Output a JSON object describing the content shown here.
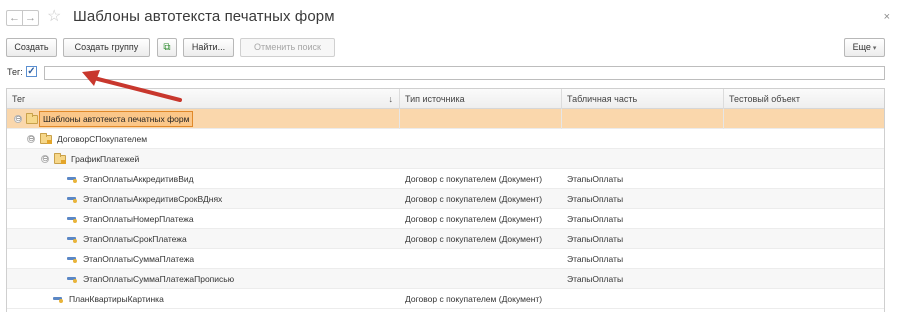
{
  "window": {
    "title": "Шаблоны автотекста печатных форм",
    "back_glyph": "←",
    "forward_glyph": "→",
    "star_glyph": "☆",
    "close_glyph": "×"
  },
  "toolbar": {
    "create_label": "Создать",
    "create_group_label": "Создать группу",
    "copy_glyph": "⧉",
    "find_label": "Найти...",
    "cancel_search_label": "Отменить поиск",
    "more_label": "Еще",
    "more_caret": "▾"
  },
  "filter": {
    "tag_label": "Тег:",
    "checked": true,
    "check_glyph": "✓",
    "value": ""
  },
  "table": {
    "columns": [
      "Тег",
      "Тип источника",
      "Табличная часть",
      "Тестовый объект"
    ],
    "sort_glyph": "↓",
    "rows": [
      {
        "tag": "Шаблоны автотекста печатных форм",
        "source": "",
        "tabular": "",
        "test": "",
        "kind": "root",
        "selected": true
      },
      {
        "tag": "ДоговорСПокупателем",
        "source": "",
        "tabular": "",
        "test": "",
        "kind": "group"
      },
      {
        "tag": "ГрафикПлатежей",
        "source": "",
        "tabular": "",
        "test": "",
        "kind": "group"
      },
      {
        "tag": "ЭтапОплатыАккредитивВид",
        "source": "Договор с покупателем (Документ)",
        "tabular": "ЭтапыОплаты",
        "test": "",
        "kind": "item"
      },
      {
        "tag": "ЭтапОплатыАккредитивСрокВДнях",
        "source": "Договор с покупателем (Документ)",
        "tabular": "ЭтапыОплаты",
        "test": "",
        "kind": "item"
      },
      {
        "tag": "ЭтапОплатыНомерПлатежа",
        "source": "Договор с покупателем (Документ)",
        "tabular": "ЭтапыОплаты",
        "test": "",
        "kind": "item"
      },
      {
        "tag": "ЭтапОплатыСрокПлатежа",
        "source": "Договор с покупателем (Документ)",
        "tabular": "ЭтапыОплаты",
        "test": "",
        "kind": "item"
      },
      {
        "tag": "ЭтапОплатыСуммаПлатежа",
        "source": "",
        "tabular": "ЭтапыОплаты",
        "test": "",
        "kind": "item"
      },
      {
        "tag": "ЭтапОплатыСуммаПлатежаПрописью",
        "source": "",
        "tabular": "ЭтапыОплаты",
        "test": "",
        "kind": "item"
      },
      {
        "tag": "ПланКвартирыКартинка",
        "source": "Договор с покупателем (Документ)",
        "tabular": "",
        "test": "",
        "kind": "item"
      }
    ],
    "expand_glyph": "⊖"
  },
  "colors": {
    "selected_row": "#fad7ac",
    "highlight": "#fbc789",
    "highlight_border": "#e0892a",
    "annotation_arrow": "#c8372d"
  }
}
